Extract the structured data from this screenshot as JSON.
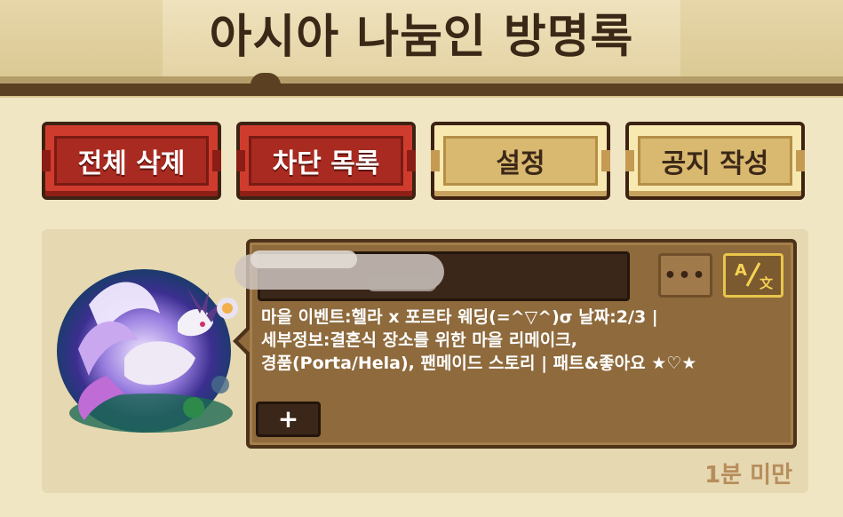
{
  "header": {
    "title": "아시아 나눔인 방명록"
  },
  "toolbar": {
    "delete_all_label": "전체 삭제",
    "block_list_label": "차단 목록",
    "settings_label": "설정",
    "write_notice_label": "공지 작성"
  },
  "entry": {
    "more_label": "•••",
    "message": "마을 이벤트:헬라 x 포르타 웨딩(=^▽^)σ 날짜:2/3 |\n세부정보:결혼식 장소를 위한 마을 리메이크,\n경품(Porta/Hela), 팬메이드 스토리 | 패트&좋아요 ★♡★",
    "plus_label": "+",
    "timestamp": "1분 미만"
  },
  "colors": {
    "background": "#f1e6c4",
    "header_dark": "#5b4021",
    "button_red": "#cf3c2e",
    "button_tan": "#d9b870",
    "panel": "#8e6a3c",
    "timestamp": "#b78d5c"
  },
  "icons": [
    "more-icon",
    "translate-icon",
    "plus-icon",
    "dragon-avatar"
  ]
}
